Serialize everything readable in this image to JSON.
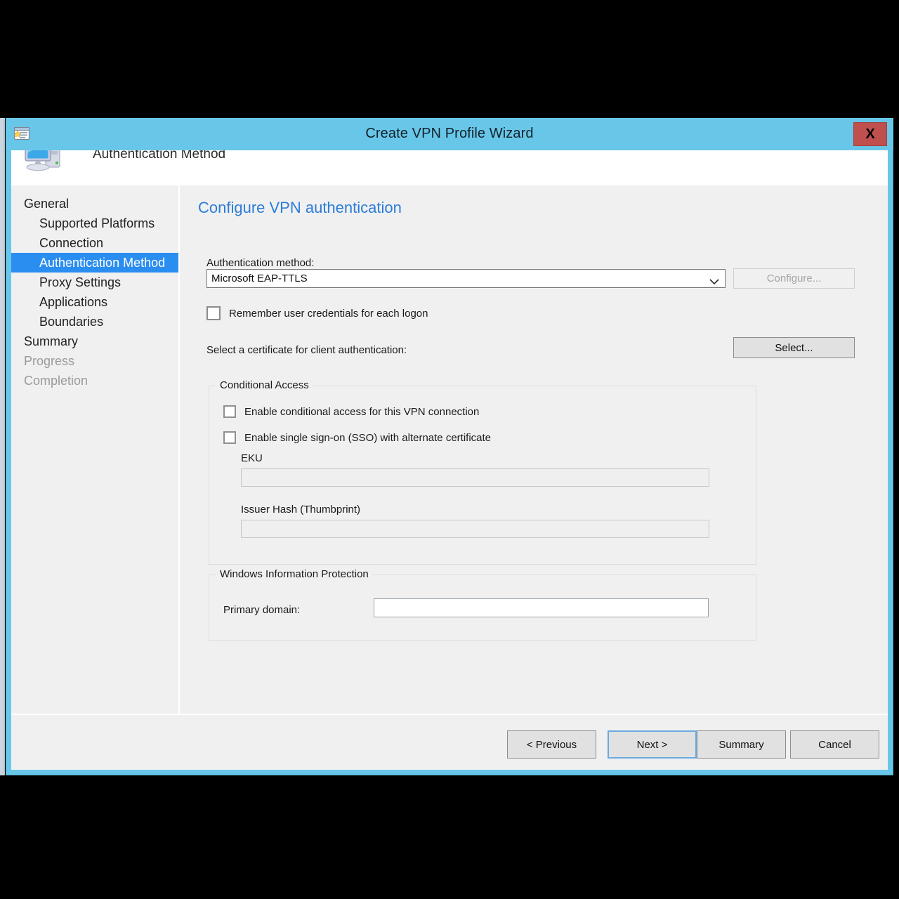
{
  "window": {
    "title": "Create VPN Profile Wizard",
    "title_icon": "wizard-document-icon",
    "close_label": "X",
    "accent_color": "#68c7e8",
    "close_color": "#c0504d"
  },
  "header": {
    "icon": "computer-monitor-icon",
    "title": "Authentication Method"
  },
  "sidebar": {
    "items": [
      {
        "label": "General",
        "indent": false,
        "state": "normal"
      },
      {
        "label": "Supported Platforms",
        "indent": true,
        "state": "normal"
      },
      {
        "label": "Connection",
        "indent": true,
        "state": "normal"
      },
      {
        "label": "Authentication Method",
        "indent": true,
        "state": "selected"
      },
      {
        "label": "Proxy Settings",
        "indent": true,
        "state": "normal"
      },
      {
        "label": "Applications",
        "indent": true,
        "state": "normal"
      },
      {
        "label": "Boundaries",
        "indent": true,
        "state": "normal"
      },
      {
        "label": "Summary",
        "indent": false,
        "state": "normal"
      },
      {
        "label": "Progress",
        "indent": false,
        "state": "dim"
      },
      {
        "label": "Completion",
        "indent": false,
        "state": "dim"
      }
    ],
    "selected_color": "#2a8df0"
  },
  "content": {
    "heading": "Configure VPN authentication",
    "heading_color": "#2b7cd8",
    "auth_method": {
      "label": "Authentication method:",
      "value": "Microsoft EAP-TTLS",
      "options": [
        "Microsoft EAP-TTLS"
      ],
      "configure_label": "Configure...",
      "configure_enabled": false
    },
    "remember_credentials": {
      "label": "Remember user credentials for each logon",
      "checked": false
    },
    "certificate": {
      "label": "Select a certificate for client authentication:",
      "select_label": "Select..."
    },
    "conditional_access": {
      "legend": "Conditional Access",
      "enable_conditional_access": {
        "label": "Enable conditional access for this VPN connection",
        "checked": false
      },
      "enable_sso": {
        "label": "Enable single sign-on (SSO) with alternate certificate",
        "checked": false
      },
      "eku": {
        "label": "EKU",
        "value": "",
        "placeholder": "",
        "enabled": false
      },
      "issuer_hash": {
        "label": "Issuer Hash (Thumbprint)",
        "value": "",
        "placeholder": "",
        "enabled": false
      }
    },
    "windows_information_protection": {
      "legend": "Windows Information Protection",
      "primary_domain": {
        "label": "Primary domain:",
        "value": "",
        "placeholder": "",
        "enabled": true
      }
    }
  },
  "footer": {
    "previous_label": "< Previous",
    "next_label": "Next >",
    "summary_label": "Summary",
    "cancel_label": "Cancel",
    "default_button": "Next >"
  }
}
